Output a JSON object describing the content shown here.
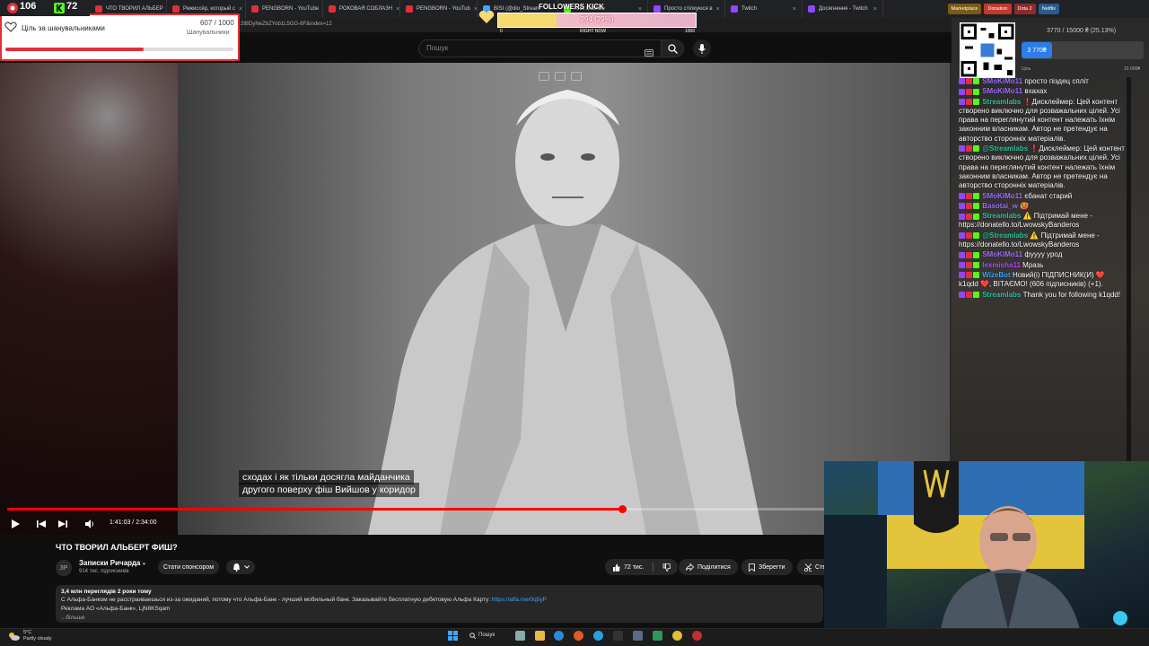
{
  "overlay": {
    "badge_count_1": "106",
    "badge_count_2": "72",
    "goal_title": "Ціль за шанувальниками",
    "goal_count": "607 / 1000",
    "goal_sub": "Шанувальники",
    "goal_progress": 0.607,
    "followers_title": "FOLLOWERS KICK",
    "followers_value": "294 (29%)",
    "followers_min": "0",
    "followers_now": "RIGHT NOW",
    "followers_max": "1000",
    "followers_progress": 0.294
  },
  "browser": {
    "tabs": [
      {
        "label": "ЧТО ТВОРИЛ АЛЬБЕР",
        "color": "#e0303a"
      },
      {
        "label": "Режиссёр, который с",
        "color": "#e0303a"
      },
      {
        "label": "PENGBORN - YouTube",
        "color": "#e0303a"
      },
      {
        "label": "РОКОВАЯ СОБЛАЗН",
        "color": "#e0303a"
      },
      {
        "label": "PENGBORN - YouTub",
        "color": "#e0303a"
      },
      {
        "label": "BISI (@dio_Stream",
        "color": "#3ea6ff"
      },
      {
        "label": "Kick Dashbo",
        "color": "#53fc18"
      },
      {
        "label": "Просто стілкуюся в",
        "color": "#9146ff"
      },
      {
        "label": "Twitch",
        "color": "#9146ff"
      },
      {
        "label": "Досягнення - Twitch",
        "color": "#9146ff"
      }
    ],
    "bookmarks": [
      {
        "label": "Marketplace",
        "color": "#7a5a14"
      },
      {
        "label": "Donation",
        "color": "#c0392b"
      },
      {
        "label": "Dota 2",
        "color": "#8e2a2a"
      },
      {
        "label": "Netflix",
        "color": "#2a5a8e"
      }
    ],
    "address": "2tBDyNeZbZYob1L5GG-8F&index=12"
  },
  "youtube": {
    "search_placeholder": "Пошук",
    "subtitle_line1": "сходах і як тільки досягла майданчика",
    "subtitle_line2": "другого поверху фіш Вийшов у коридор",
    "time": "1:41:03 / 2:34:00",
    "progress": 0.656,
    "video_title": "ЧТО ТВОРИЛ АЛЬБЕРТ ФИШ?",
    "channel_avatar_text": "ЗР",
    "channel_name": "Записки Ричарда",
    "channel_subs": "914 тис. підписників",
    "sponsor_label": "Стати спонсором",
    "likes": "72 тис.",
    "share": "Поділитися",
    "save": "Зберегти",
    "cut": "Ств",
    "desc_stats": "3,4 млн переглядів  2 роки тому",
    "desc_line2": "С Альфа-Банком не расстраиваешься из-за ожиданий, потому что Альфа-Банк - лучший мобильный банк. Заказывайте бесплатную дебетовую Альфа Карту: ",
    "desc_link": "https://alfa.me/0q5yP",
    "desc_line3": "Реклама АО «Альфа-Банк», LjN8KSqam",
    "desc_more": "...більше"
  },
  "donation": {
    "text": "3770 / 15000 ₴ (25.13%)",
    "current": "3 770₴",
    "goal_label": "Ціль",
    "max": "15 000₴",
    "progress": 0.2513
  },
  "chat": [
    {
      "user": "SMoKiMo11",
      "text": "просто піздец спліт",
      "color": "#a070ff"
    },
    {
      "user": "SMoKiMo11",
      "text": "вхахах",
      "color": "#a070ff"
    },
    {
      "user": "Streamlabs",
      "text": "❗Дисклеймер: Цей контент створено виключно для розважальних цілей. Усі права на переглянутий контент належать їхнім законним власникам. Автор не претендує на авторство сторонніх матеріалів.",
      "color": "#31c3a2"
    },
    {
      "user": "@Streamlabs",
      "text": "❗Дисклеймер: Цей контент створено виключно для розважальних цілей. Усі права на переглянутий контент належать їхнім законним власникам. Автор не претендує на авторство сторонніх матеріалів.",
      "color": "#31c3a2"
    },
    {
      "user": "SMoKiMo11",
      "text": "єбанат старий",
      "color": "#a070ff"
    },
    {
      "user": "Basotai_w",
      "text": "🥵",
      "color": "#a070ff"
    },
    {
      "user": "Streamlabs",
      "text": "⚠️ Підтримай мене - https://donatello.to/LwowskyBanderos",
      "color": "#31c3a2"
    },
    {
      "user": "@Streamlabs",
      "text": "⚠️ Підтримай мене - https://donatello.to/LwowskyBanderos",
      "color": "#31c3a2"
    },
    {
      "user": "SMoKiMo11",
      "text": "фуууу урод",
      "color": "#a070ff"
    },
    {
      "user": "lexmisha11",
      "text": "Мразь",
      "color": "#b050ff"
    },
    {
      "user": "WizeBot",
      "text": "Новий(і) ПІДПИСНИК(И) ❤️ k1qdd ❤️, ВІТАЄМО! (606 підписників) (+1).",
      "color": "#3ea6ff"
    },
    {
      "user": "Streamlabs",
      "text": "Thank you for following k1qdd!",
      "color": "#31c3a2"
    }
  ],
  "taskbar": {
    "temp": "5°C",
    "weather": "Partly cloudy",
    "search": "Пошук"
  }
}
